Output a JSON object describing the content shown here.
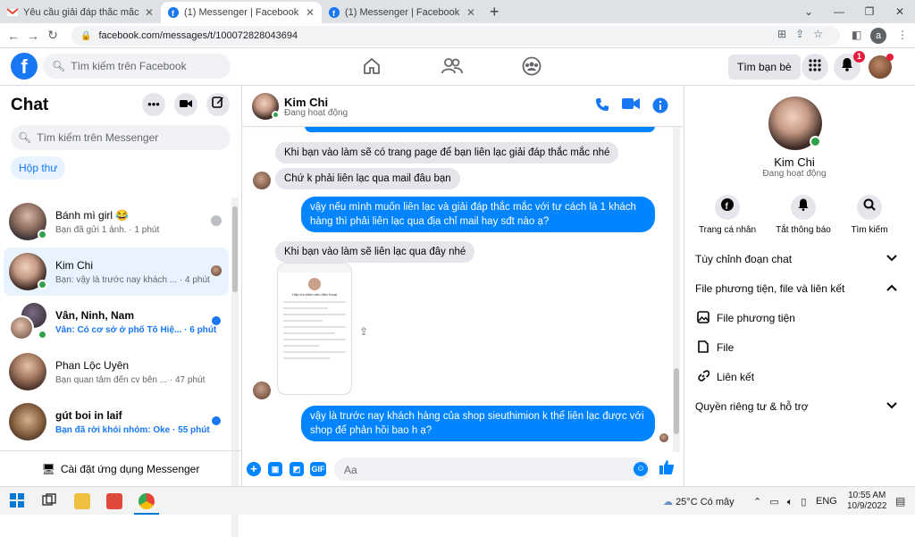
{
  "browser": {
    "tabs": [
      {
        "title": "Yêu cầu giải đáp thắc mắc - anht"
      },
      {
        "title": "(1) Messenger | Facebook"
      },
      {
        "title": "(1) Messenger | Facebook"
      }
    ],
    "url": "facebook.com/messages/t/100072828043694",
    "profile_initial": "a"
  },
  "fb": {
    "search_placeholder": "Tìm kiếm trên Facebook",
    "find_friends": "Tìm bạn bè",
    "notif_count": "1"
  },
  "left": {
    "title": "Chat",
    "search_placeholder": "Tìm kiếm trên Messenger",
    "inbox_label": "Hộp thư",
    "install_label": "Cài đặt ứng dụng Messenger",
    "conversations": [
      {
        "name": "Bánh mì girl 😂",
        "preview": "Bạn đã gửi 1 ảnh.",
        "time": "1 phút",
        "unread": false
      },
      {
        "name": "Kim Chi",
        "preview": "Bạn: vậy là trước nay khách ...",
        "time": "4 phút",
        "unread": false
      },
      {
        "name": "Vân, Ninh, Nam",
        "preview": "Vân: Có cơ sở ở phố Tô Hiệ...",
        "time": "6 phút",
        "unread": true
      },
      {
        "name": "Phan Lộc Uyên",
        "preview": "Bạn quan tâm đến cv bên ...",
        "time": "47 phút",
        "unread": false
      },
      {
        "name": "gút boi in laif",
        "preview": "Bạn đã rời khỏi nhóm: Oke",
        "time": "55 phút",
        "unread": true
      }
    ]
  },
  "chat": {
    "name": "Kim Chi",
    "status": "Đang hoạt động",
    "composer_placeholder": "Aa",
    "gif_label": "GIF",
    "messages": [
      {
        "from": "in",
        "text": "Khi bạn vào làm sẽ có trang page để bạn liên lạc giải đáp thắc mắc nhé"
      },
      {
        "from": "in",
        "text": "Chứ k phải liên lạc qua mail đâu bạn"
      },
      {
        "from": "out",
        "text": "vậy nếu mình muốn liên lạc và giải đáp thắc mắc với tư cách là 1 khách hàng thì phải liên lạc qua địa chỉ mail hay sđt nào ạ?"
      },
      {
        "from": "in",
        "text": "Khi bạn vào làm sẽ liên lạc qua đây nhé"
      },
      {
        "from": "in",
        "text": "[image]"
      },
      {
        "from": "out",
        "text": "vậy là trước nay khách hàng của shop sieuthimion k thể liên lạc được với shop để phản hồi bao h ạ?"
      }
    ],
    "shot_title": "Hãy tìm kiếm trên điện thoại"
  },
  "right": {
    "name": "Kim Chi",
    "status": "Đang hoạt động",
    "actions": [
      "Trang cá nhân",
      "Tắt thông báo",
      "Tìm kiếm"
    ],
    "sections": [
      {
        "label": "Tùy chỉnh đoạn chat",
        "expanded": false
      },
      {
        "label": "File phương tiện, file và liên kết",
        "expanded": true
      },
      {
        "label": "File phương tiện",
        "sub": true
      },
      {
        "label": "File",
        "sub": true
      },
      {
        "label": "Liên kết",
        "sub": true
      },
      {
        "label": "Quyền riêng tư & hỗ trợ",
        "expanded": false
      }
    ]
  },
  "taskbar": {
    "weather": "25°C Có mây",
    "lang": "ENG",
    "time": "10:55 AM",
    "date": "10/9/2022"
  },
  "colors": {
    "fb_blue": "#1877f2",
    "messenger_blue": "#0084ff",
    "online_green": "#31a24c",
    "notif_red": "#e41e3f"
  }
}
